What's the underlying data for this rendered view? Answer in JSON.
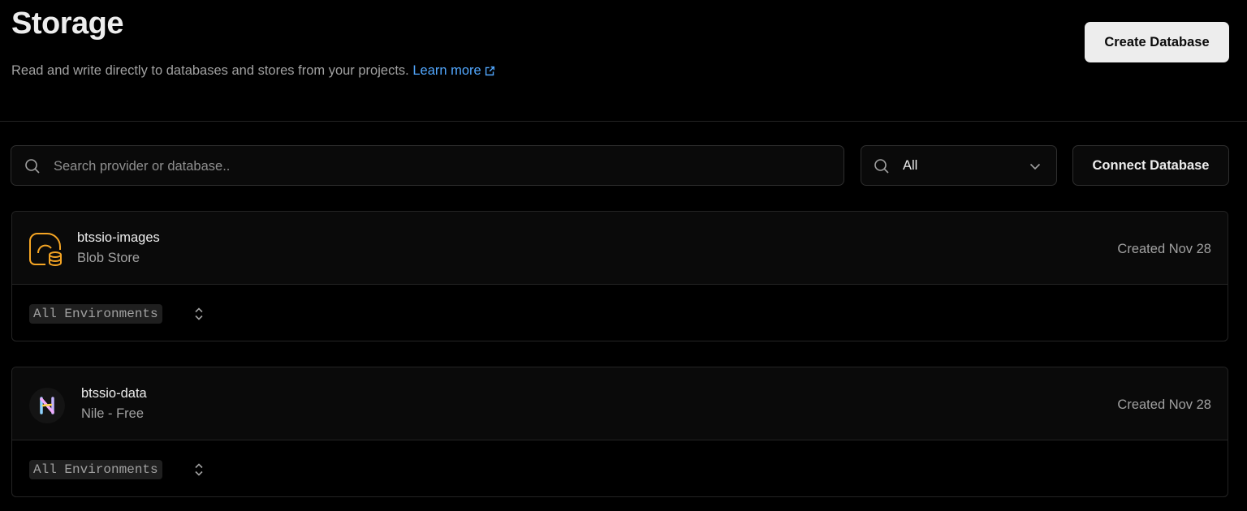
{
  "header": {
    "title": "Storage",
    "subtitle": "Read and write directly to databases and stores from your projects.",
    "learn_more": "Learn more",
    "create_button": "Create Database"
  },
  "toolbar": {
    "search_placeholder": "Search provider or database..",
    "filter_value": "All",
    "connect_button": "Connect Database"
  },
  "stores": [
    {
      "name": "btssio-images",
      "type": "Blob Store",
      "created": "Created Nov 28",
      "environment": "All Environments",
      "icon": "blob-store-icon"
    },
    {
      "name": "btssio-data",
      "type": "Nile - Free",
      "created": "Created Nov 28",
      "environment": "All Environments",
      "icon": "nile-logo-icon"
    }
  ],
  "colors": {
    "background": "#000000",
    "accent_link": "#52a8ff",
    "blob_icon": "#f5a524"
  }
}
